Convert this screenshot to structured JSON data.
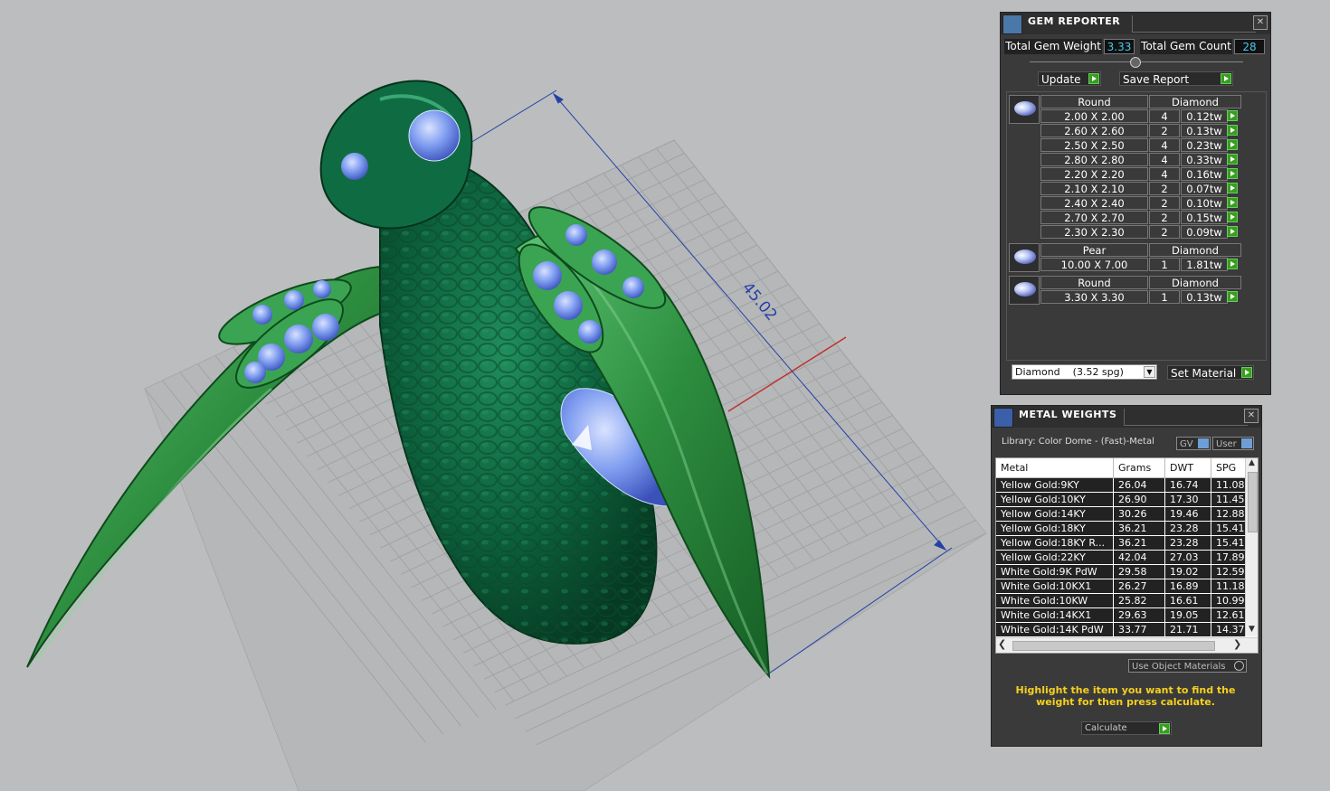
{
  "viewport": {
    "dimension_label": "45.02"
  },
  "gem_reporter": {
    "title": "GEM REPORTER",
    "total_weight_label": "Total Gem Weight",
    "total_weight_value": "3.33",
    "total_count_label": "Total Gem Count",
    "total_count_value": "28",
    "update_label": "Update",
    "save_report_label": "Save Report",
    "groups": [
      {
        "shape": "Round",
        "material": "Diamond",
        "rows": [
          {
            "size": "2.00 X 2.00",
            "count": "4",
            "weight": "0.12tw"
          },
          {
            "size": "2.60 X 2.60",
            "count": "2",
            "weight": "0.13tw"
          },
          {
            "size": "2.50 X 2.50",
            "count": "4",
            "weight": "0.23tw"
          },
          {
            "size": "2.80 X 2.80",
            "count": "4",
            "weight": "0.33tw"
          },
          {
            "size": "2.20 X 2.20",
            "count": "4",
            "weight": "0.16tw"
          },
          {
            "size": "2.10 X 2.10",
            "count": "2",
            "weight": "0.07tw"
          },
          {
            "size": "2.40 X 2.40",
            "count": "2",
            "weight": "0.10tw"
          },
          {
            "size": "2.70 X 2.70",
            "count": "2",
            "weight": "0.15tw"
          },
          {
            "size": "2.30 X 2.30",
            "count": "2",
            "weight": "0.09tw"
          }
        ]
      },
      {
        "shape": "Pear",
        "material": "Diamond",
        "rows": [
          {
            "size": "10.00 X 7.00",
            "count": "1",
            "weight": "1.81tw"
          }
        ]
      },
      {
        "shape": "Round",
        "material": "Diamond",
        "rows": [
          {
            "size": "3.30 X 3.30",
            "count": "1",
            "weight": "0.13tw"
          }
        ]
      }
    ],
    "material_select": "Diamond    (3.52 spg)",
    "set_material_label": "Set Material"
  },
  "metal_weights": {
    "title": "METAL WEIGHTS",
    "library_label": "Library: Color Dome - (Fast)-Metal",
    "gv_label": "GV",
    "user_label": "User",
    "columns": [
      "Metal",
      "Grams",
      "DWT",
      "SPG"
    ],
    "rows": [
      [
        "Yellow Gold:9KY",
        "26.04",
        "16.74",
        "11.08"
      ],
      [
        "Yellow Gold:10KY",
        "26.90",
        "17.30",
        "11.45"
      ],
      [
        "Yellow Gold:14KY",
        "30.26",
        "19.46",
        "12.88"
      ],
      [
        "Yellow Gold:18KY",
        "36.21",
        "23.28",
        "15.41"
      ],
      [
        "Yellow Gold:18KY R...",
        "36.21",
        "23.28",
        "15.41"
      ],
      [
        "Yellow Gold:22KY",
        "42.04",
        "27.03",
        "17.89"
      ],
      [
        "White Gold:9K PdW",
        "29.58",
        "19.02",
        "12.59"
      ],
      [
        "White Gold:10KX1",
        "26.27",
        "16.89",
        "11.18"
      ],
      [
        "White Gold:10KW",
        "25.82",
        "16.61",
        "10.99"
      ],
      [
        "White Gold:14KX1",
        "29.63",
        "19.05",
        "12.61"
      ],
      [
        "White Gold:14K PdW",
        "33.77",
        "21.71",
        "14.37"
      ]
    ],
    "use_object_materials_label": "Use Object Materials",
    "hint": "Highlight the item you want to find the weight for then press calculate.",
    "calculate_label": "Calculate"
  }
}
